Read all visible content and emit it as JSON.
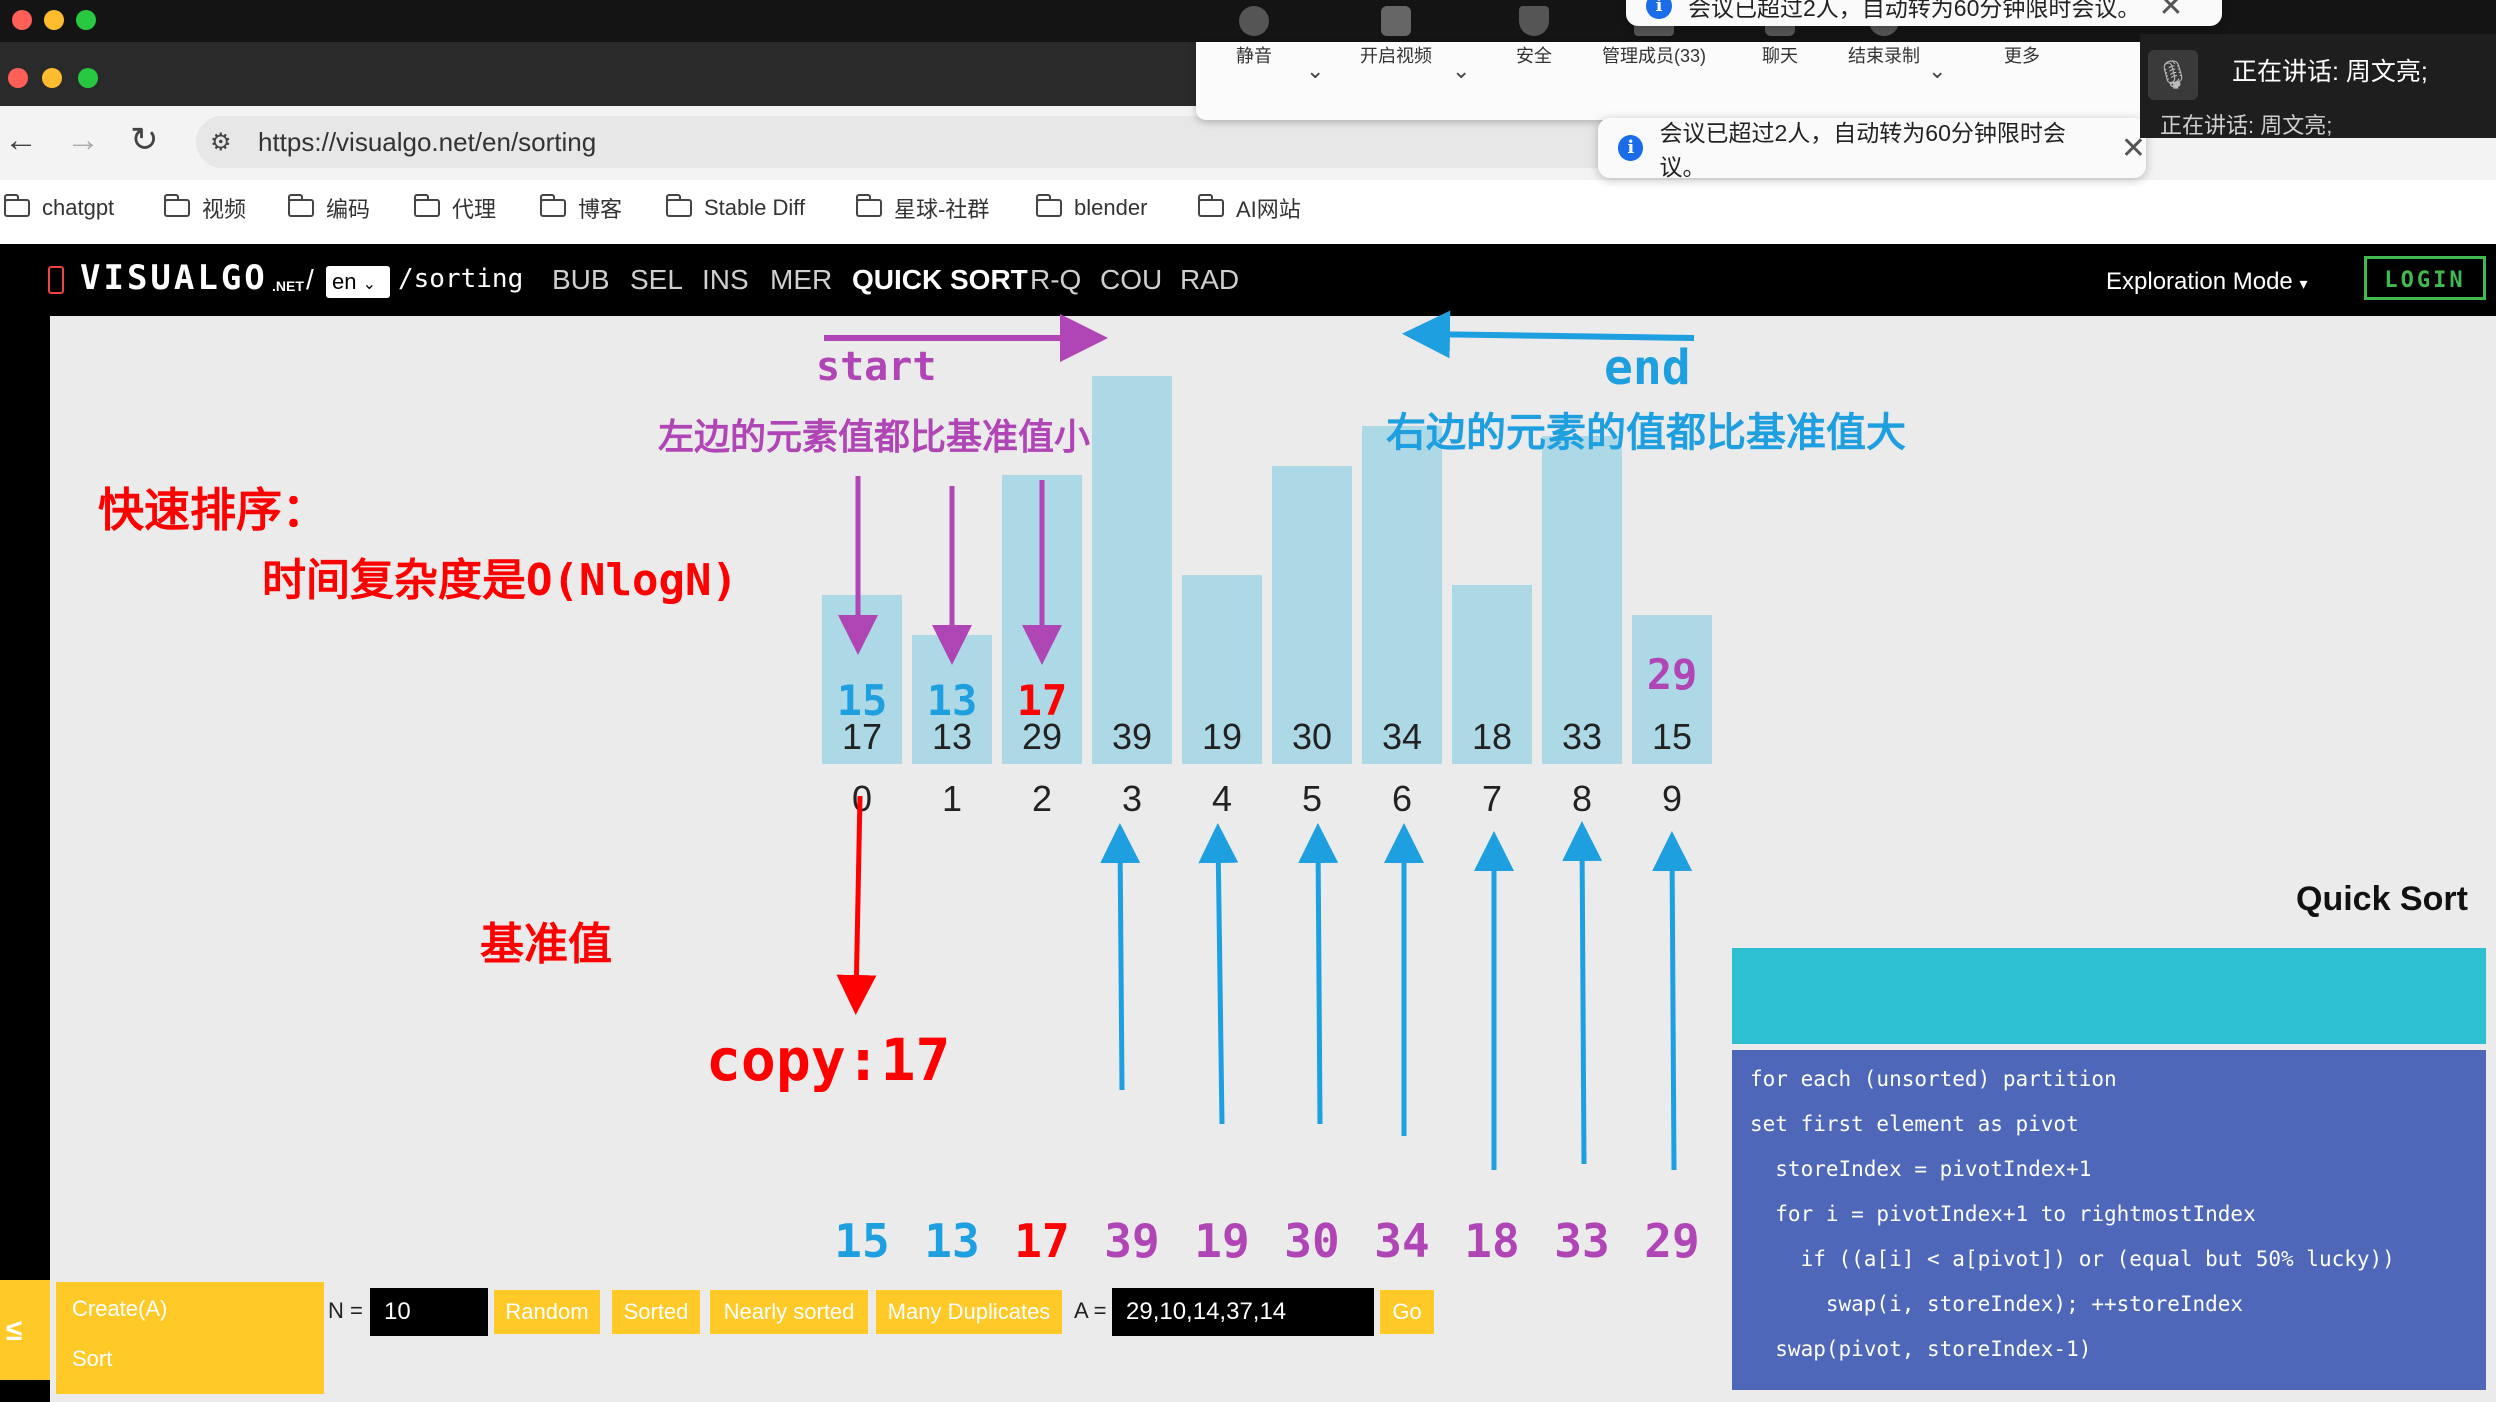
{
  "meeting": {
    "buttons": [
      {
        "label": "静音",
        "icon": "microphone-icon"
      },
      {
        "label": "开启视频",
        "icon": "video-off-icon"
      },
      {
        "label": "安全",
        "icon": "shield-icon"
      },
      {
        "label": "管理成员(33)",
        "icon": "participants-icon"
      },
      {
        "label": "聊天",
        "icon": "chat-icon"
      },
      {
        "label": "结束录制",
        "icon": "stop-record-icon"
      },
      {
        "label": "更多",
        "icon": "more-icon"
      }
    ],
    "toast_text": "会议已超过2人，自动转为60分钟限时会议。",
    "speaking": "正在讲话: 周文亮;",
    "speaking_ghost": "正在讲话: 周文亮;"
  },
  "browser": {
    "url": "https://visualgo.net/en/sorting",
    "bookmarks": [
      "chatgpt",
      "视频",
      "编码",
      "代理",
      "博客",
      "Stable Diff",
      "星球-社群",
      "blender",
      "AI网站"
    ]
  },
  "visualgo": {
    "logo": "VISUALGO",
    "logo_suffix": ".NET",
    "lang": "en",
    "path": "/sorting",
    "nav": [
      "BUB",
      "SEL",
      "INS",
      "MER",
      "QUICK SORT",
      "R-Q",
      "COU",
      "RAD"
    ],
    "mode": "Exploration Mode",
    "login": "LOGIN"
  },
  "array": {
    "values": [
      17,
      13,
      29,
      39,
      19,
      30,
      34,
      18,
      33,
      15
    ],
    "indices": [
      "0",
      "1",
      "2",
      "3",
      "4",
      "5",
      "6",
      "7",
      "8",
      "9"
    ]
  },
  "annotations": {
    "start": "start",
    "end": "end",
    "left_note": "左边的元素值都比基准值小",
    "right_note": "右边的元素的值都比基准值大",
    "title1": "快速排序：",
    "title2": "时间复杂度是O(NlogN)",
    "pivot_label": "基准值",
    "copy": "copy:17",
    "over": [
      {
        "text": "15",
        "color": "#1e9fe0"
      },
      {
        "text": "13",
        "color": "#1e9fe0"
      },
      {
        "text": "17",
        "color": "#ff0000"
      },
      {
        "text": "29",
        "color": "#b045b5"
      }
    ],
    "bottom_row": [
      {
        "text": "15",
        "color": "#1e9fe0"
      },
      {
        "text": "13",
        "color": "#1e9fe0"
      },
      {
        "text": "17",
        "color": "#ff0000"
      },
      {
        "text": "39",
        "color": "#b045b5"
      },
      {
        "text": "19",
        "color": "#b045b5"
      },
      {
        "text": "30",
        "color": "#b045b5"
      },
      {
        "text": "34",
        "color": "#b045b5"
      },
      {
        "text": "18",
        "color": "#b045b5"
      },
      {
        "text": "33",
        "color": "#b045b5"
      },
      {
        "text": "29",
        "color": "#b045b5"
      }
    ]
  },
  "controls": {
    "create": "Create(A)",
    "sort": "Sort",
    "n_label": "N =",
    "n_value": "10",
    "random": "Random",
    "sorted": "Sorted",
    "nearly": "Nearly sorted",
    "dups": "Many Duplicates",
    "a_label": "A =",
    "a_value": "29,10,14,37,14",
    "go": "Go"
  },
  "panel": {
    "title": "Quick Sort",
    "code": [
      "for each (unsorted) partition",
      "set first element as pivot",
      "  storeIndex = pivotIndex+1",
      "  for i = pivotIndex+1 to rightmostIndex",
      "    if ((a[i] < a[pivot]) or (equal but 50% lucky))",
      "      swap(i, storeIndex); ++storeIndex",
      "  swap(pivot, storeIndex-1)"
    ]
  },
  "colors": {
    "accent_purple": "#b045b5",
    "accent_blue": "#1e9fe0",
    "accent_red": "#ff0000",
    "bar": "#add8e6",
    "code_panel": "#4f67b8",
    "status_header": "#2dbfd2",
    "button_yellow": "#ffc928"
  }
}
